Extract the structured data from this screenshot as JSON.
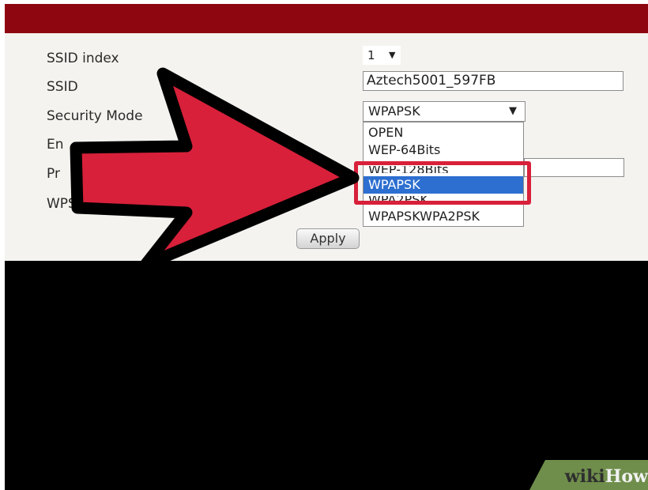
{
  "form": {
    "labels": {
      "ssid_index": "SSID index",
      "ssid": "SSID",
      "security_mode": "Security Mode",
      "encryption_partial": "En",
      "passphrase_partial": "Pr",
      "wps": "WPS"
    },
    "ssid_index_value": "1",
    "ssid_value": "Aztech5001_597FB",
    "security_mode_value": "WPAPSK",
    "options": [
      "OPEN",
      "WEP-64Bits",
      "WEP-128Bits",
      "WPAPSK",
      "WPA2PSK",
      "WPAPSKWPA2PSK"
    ],
    "apply_label": "Apply"
  },
  "watermark": {
    "wiki": "wiki",
    "how": "How"
  },
  "colors": {
    "top_bar": "#8e0710",
    "arrow_fill": "#d8203a",
    "highlight": "#2d6fd0"
  },
  "icons": {
    "dropdown": "triangle-down-icon",
    "annotation": "red-arrow-icon"
  }
}
